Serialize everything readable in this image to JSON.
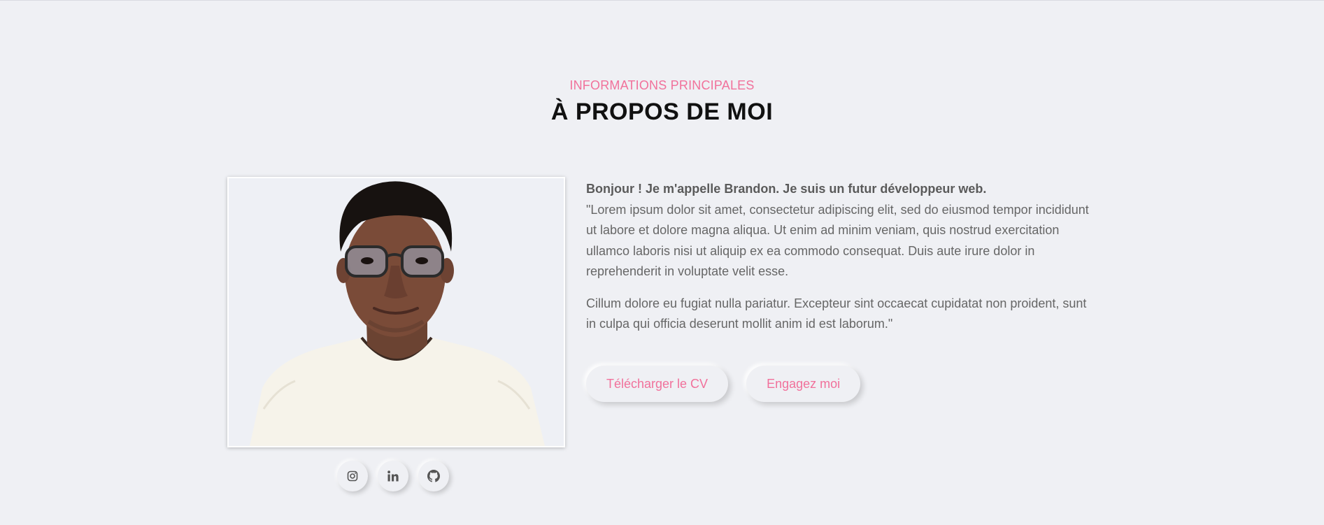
{
  "about": {
    "eyebrow": "INFORMATIONS PRINCIPALES",
    "title": "À PROPOS DE MOI",
    "intro": "Bonjour ! Je m'appelle Brandon. Je suis un futur développeur web.",
    "paragraph1": "\"Lorem ipsum dolor sit amet, consectetur adipiscing elit, sed do eiusmod tempor incididunt ut labore et dolore magna aliqua. Ut enim ad minim veniam, quis nostrud exercitation ullamco laboris nisi ut aliquip ex ea commodo consequat. Duis aute irure dolor in reprehenderit in voluptate velit esse.",
    "paragraph2": "Cillum dolore eu fugiat nulla pariatur. Excepteur sint occaecat cupidatat non proident, sunt in culpa qui officia deserunt mollit anim id est laborum.\"",
    "buttons": {
      "download_cv": "Télécharger le CV",
      "hire_me": "Engagez moi"
    },
    "socials": [
      {
        "icon": "instagram-icon"
      },
      {
        "icon": "linkedin-icon"
      },
      {
        "icon": "github-icon"
      }
    ]
  },
  "colors": {
    "accent": "#f1719b",
    "background": "#eff0f4",
    "title": "#111111",
    "body_text": "#666666"
  }
}
